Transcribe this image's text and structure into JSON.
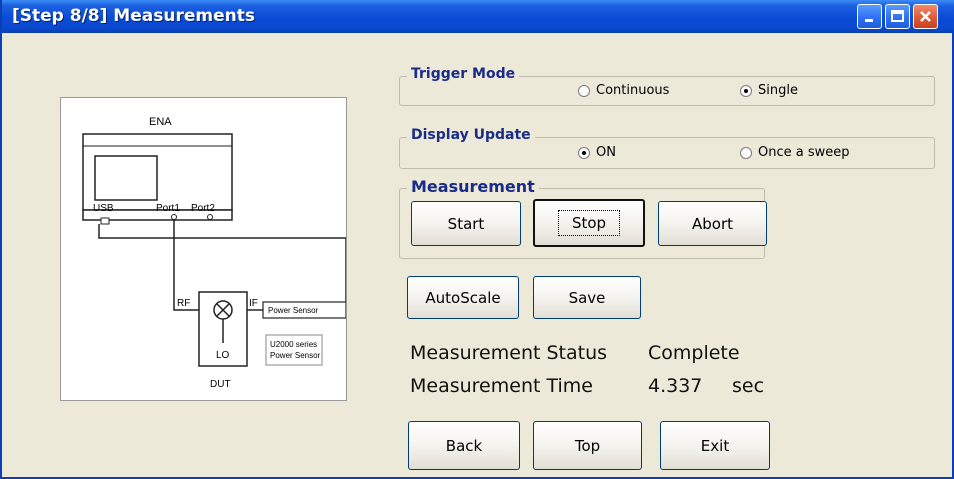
{
  "window": {
    "title": "[Step 8/8] Measurements"
  },
  "diagram": {
    "ena_label": "ENA",
    "usb_label": "USB",
    "port1_label": "Port1",
    "port2_label": "Port2",
    "rf_label": "RF",
    "if_label": "IF",
    "lo_label": "LO",
    "dut_label": "DUT",
    "power_sensor_label": "Power Sensor",
    "sensor_caption_line1": "U2000 series",
    "sensor_caption_line2": "Power Sensor"
  },
  "trigger_mode": {
    "title": "Trigger Mode",
    "options": [
      {
        "label": "Continuous",
        "selected": false
      },
      {
        "label": "Single",
        "selected": true
      }
    ]
  },
  "display_update": {
    "title": "Display Update",
    "options": [
      {
        "label": "ON",
        "selected": true
      },
      {
        "label": "Once a sweep",
        "selected": false
      }
    ]
  },
  "measurement": {
    "title": "Measurement",
    "start_label": "Start",
    "stop_label": "Stop",
    "abort_label": "Abort"
  },
  "actions": {
    "autoscale_label": "AutoScale",
    "save_label": "Save"
  },
  "status": {
    "status_label": "Measurement Status",
    "status_value": "Complete",
    "time_label": "Measurement Time",
    "time_value": "4.337",
    "time_unit": "sec"
  },
  "nav": {
    "back_label": "Back",
    "top_label": "Top",
    "exit_label": "Exit"
  },
  "colors": {
    "titlebar": "#0a4bd6",
    "group_title": "#1a2b88",
    "background": "#ece9d8"
  }
}
